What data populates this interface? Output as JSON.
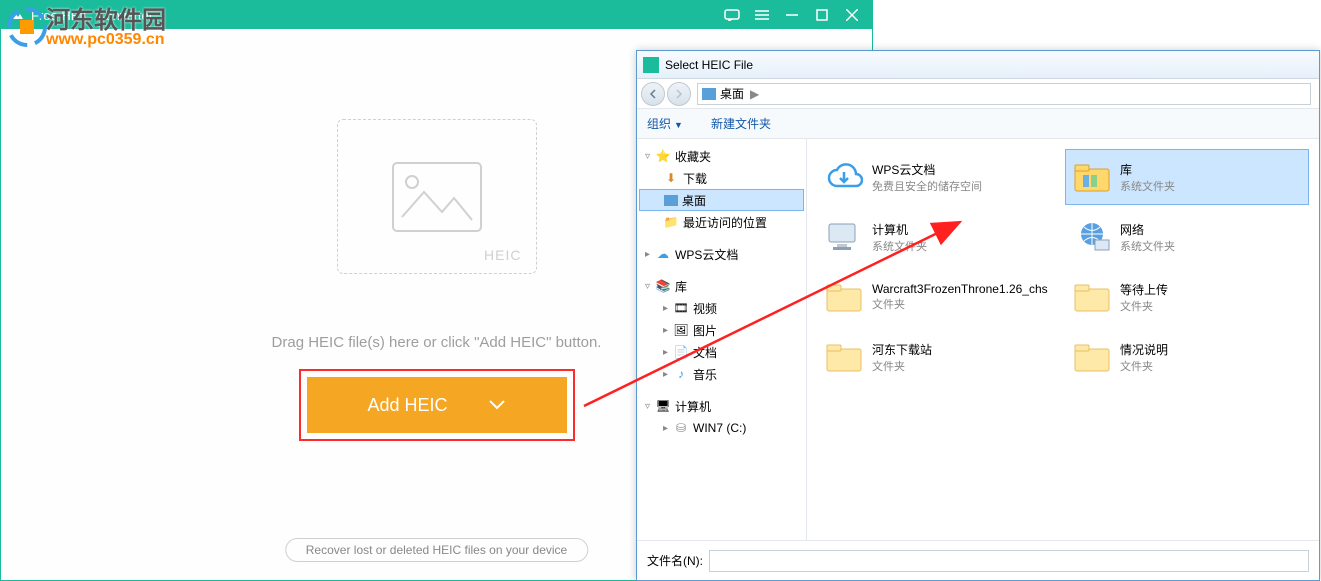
{
  "app": {
    "title": "Free HEIC Converter",
    "dropbox_label": "HEIC",
    "drag_text": "Drag HEIC file(s) here or click \"Add HEIC\" button.",
    "add_button": "Add HEIC",
    "recover_text": "Recover lost or deleted HEIC files on your device"
  },
  "dialog": {
    "title": "Select HEIC File",
    "breadcrumb": "桌面",
    "toolbar": {
      "organize": "组织",
      "newfolder": "新建文件夹"
    },
    "tree": {
      "favorites": "收藏夹",
      "downloads": "下载",
      "desktop": "桌面",
      "recent": "最近访问的位置",
      "wps": "WPS云文档",
      "libraries": "库",
      "videos": "视频",
      "pictures": "图片",
      "documents": "文档",
      "music": "音乐",
      "computer": "计算机",
      "win7": "WIN7 (C:)"
    },
    "files": [
      {
        "name": "WPS云文档",
        "sub": "免费且安全的储存空间",
        "icon": "cloud"
      },
      {
        "name": "库",
        "sub": "系统文件夹",
        "icon": "lib",
        "sel": true
      },
      {
        "name": "计算机",
        "sub": "系统文件夹",
        "icon": "pc"
      },
      {
        "name": "网络",
        "sub": "系统文件夹",
        "icon": "net"
      },
      {
        "name": "Warcraft3FrozenThrone1.26_chs",
        "sub": "文件夹",
        "icon": "folder"
      },
      {
        "name": "等待上传",
        "sub": "文件夹",
        "icon": "folder"
      },
      {
        "name": "河东下载站",
        "sub": "文件夹",
        "icon": "folder"
      },
      {
        "name": "情况说明",
        "sub": "文件夹",
        "icon": "folder"
      }
    ],
    "filename_label": "文件名(N):"
  },
  "watermark": {
    "cn": "河东软件园",
    "url": "www.pc0359.cn"
  }
}
